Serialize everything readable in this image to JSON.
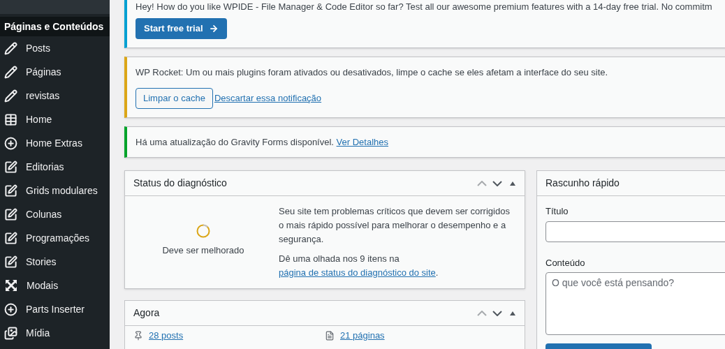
{
  "sidebar": {
    "section_title": "Páginas e Conteúdos",
    "items": [
      {
        "label": "Posts"
      },
      {
        "label": "Páginas"
      },
      {
        "label": "revistas"
      },
      {
        "label": "Home"
      },
      {
        "label": "Home Extras"
      },
      {
        "label": "Editorias"
      },
      {
        "label": "Grids modulares"
      },
      {
        "label": "Colunas"
      },
      {
        "label": "Programações"
      },
      {
        "label": "Stories"
      },
      {
        "label": "Modais"
      },
      {
        "label": "Parts Inserter"
      },
      {
        "label": "Mídia"
      }
    ]
  },
  "notices": [
    {
      "kind": "promo",
      "text": "Hey! How do you like WPIDE - File Manager & Code Editor so far? Test all our awesome premium features with a 14-day free trial. No commitm",
      "button": "Start free trial"
    },
    {
      "kind": "warning",
      "text": "WP Rocket: Um ou mais plugins foram ativados ou desativados, limpe o cache se eles afetam a interface do seu site.",
      "button": "Limpar o cache",
      "link": "Descartar essa notificação"
    },
    {
      "kind": "success",
      "text": "Há uma atualização do Gravity Forms disponível.",
      "link": "Ver Detalhes"
    }
  ],
  "site_health": {
    "title": "Status do diagnóstico",
    "status": "Deve ser melhorado",
    "message": "Seu site tem problemas críticos que devem ser corrigidos o mais rápido possível para melhorar o desempenho e a segurança.",
    "hint": "Dê uma olhada nos 9 itens na",
    "hint_link": "página de status do diagnóstico do site",
    "hint_end": "."
  },
  "at_a_glance": {
    "title": "Agora",
    "items": [
      {
        "kind": "posts",
        "label": "28 posts"
      },
      {
        "kind": "pages",
        "label": "21 páginas"
      }
    ]
  },
  "quick_draft": {
    "title": "Rascunho rápido",
    "title_label": "Título",
    "content_label": "Conteúdo",
    "content_placeholder": "O que você está pensando?"
  }
}
